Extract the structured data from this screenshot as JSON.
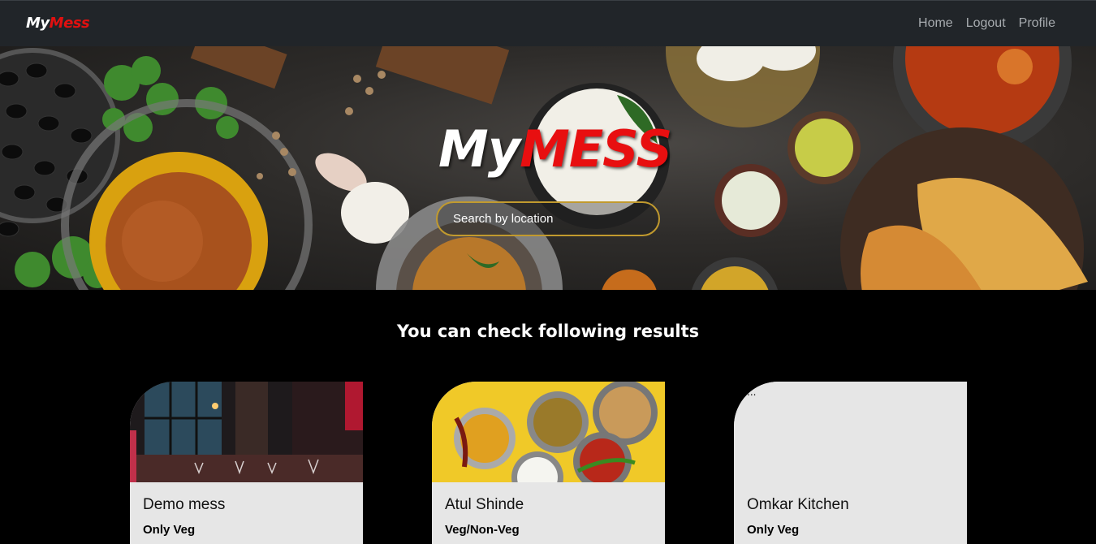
{
  "nav": {
    "brand_my": "My",
    "brand_mess": "Mess",
    "links": [
      "Home",
      "Logout",
      "Profile"
    ]
  },
  "hero": {
    "logo_my": "My",
    "logo_mess": "MESS",
    "search_placeholder": "Search by location"
  },
  "results": {
    "title": "You can check following results",
    "cards": [
      {
        "name": "Demo mess",
        "type": "Only Veg"
      },
      {
        "name": "Atul Shinde",
        "type": "Veg/Non-Veg"
      },
      {
        "name": "Omkar Kitchen",
        "type": "Only Veg",
        "image_alt": "..."
      }
    ]
  },
  "colors": {
    "navbar_bg": "#212529",
    "brand_red": "#e01010",
    "search_border": "#c19a2e",
    "card_bg": "#e6e6e6"
  }
}
